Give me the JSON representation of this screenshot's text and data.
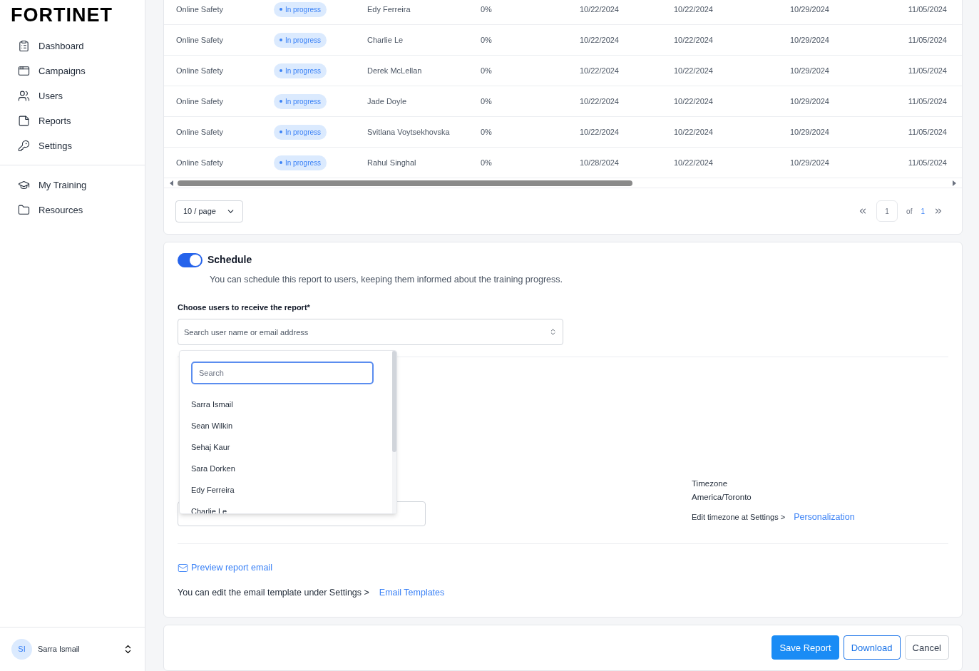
{
  "sidebar": {
    "logo": "FORTINET",
    "nav": [
      {
        "label": "Dashboard",
        "selected": false
      },
      {
        "label": "Campaigns",
        "selected": false
      },
      {
        "label": "Users",
        "selected": false
      },
      {
        "label": "Reports",
        "selected": false
      },
      {
        "label": "Settings",
        "selected": false
      }
    ],
    "nav_secondary": [
      {
        "label": "My Training",
        "selected": false
      },
      {
        "label": "Resources",
        "selected": false
      }
    ],
    "user": {
      "initials": "SI",
      "name": "Sarra Ismail"
    }
  },
  "table": {
    "rows": [
      {
        "course": "Online Safety",
        "status": "In progress",
        "user": "Edy Ferreira",
        "progress": "0%",
        "dates": [
          "10/22/2024",
          "10/22/2024",
          "10/29/2024",
          "11/05/2024"
        ]
      },
      {
        "course": "Online Safety",
        "status": "In progress",
        "user": "Charlie Le",
        "progress": "0%",
        "dates": [
          "10/22/2024",
          "10/22/2024",
          "10/29/2024",
          "11/05/2024"
        ]
      },
      {
        "course": "Online Safety",
        "status": "In progress",
        "user": "Derek McLellan",
        "progress": "0%",
        "dates": [
          "10/22/2024",
          "10/22/2024",
          "10/29/2024",
          "11/05/2024"
        ]
      },
      {
        "course": "Online Safety",
        "status": "In progress",
        "user": "Jade Doyle",
        "progress": "0%",
        "dates": [
          "10/22/2024",
          "10/22/2024",
          "10/29/2024",
          "11/05/2024"
        ]
      },
      {
        "course": "Online Safety",
        "status": "In progress",
        "user": "Svitlana Voytsekhovska",
        "progress": "0%",
        "dates": [
          "10/22/2024",
          "10/22/2024",
          "10/29/2024",
          "11/05/2024"
        ]
      },
      {
        "course": "Online Safety",
        "status": "In progress",
        "user": "Rahul Singhal",
        "progress": "0%",
        "dates": [
          "10/28/2024",
          "10/22/2024",
          "10/29/2024",
          "11/05/2024"
        ]
      }
    ],
    "page_size": "10 / page",
    "page": "1",
    "of": "of",
    "total_pages": "1"
  },
  "schedule": {
    "on": true,
    "title": "Schedule",
    "description": "You can schedule this report to users, keeping them informed about the training progress.",
    "recipients_label": "Choose users to receive the report*",
    "recipients_placeholder": "Search user name or email address",
    "dropdown": {
      "search_placeholder": "Search",
      "options": [
        "Sarra Ismail",
        "Sean Wilkin",
        "Sehaj Kaur",
        "Sara Dorken",
        "Edy Ferreira",
        "Charlie Le"
      ]
    },
    "timezone_label": "Timezone",
    "timezone": "America/Toronto",
    "timezone_hint": "Edit timezone at Settings >",
    "timezone_link": "Personalization",
    "preview_link": "Preview report email",
    "template_hint": "You can edit the email template under Settings >",
    "template_link": "Email Templates"
  },
  "actions": [
    "Save Report",
    "Download",
    "Cancel"
  ]
}
